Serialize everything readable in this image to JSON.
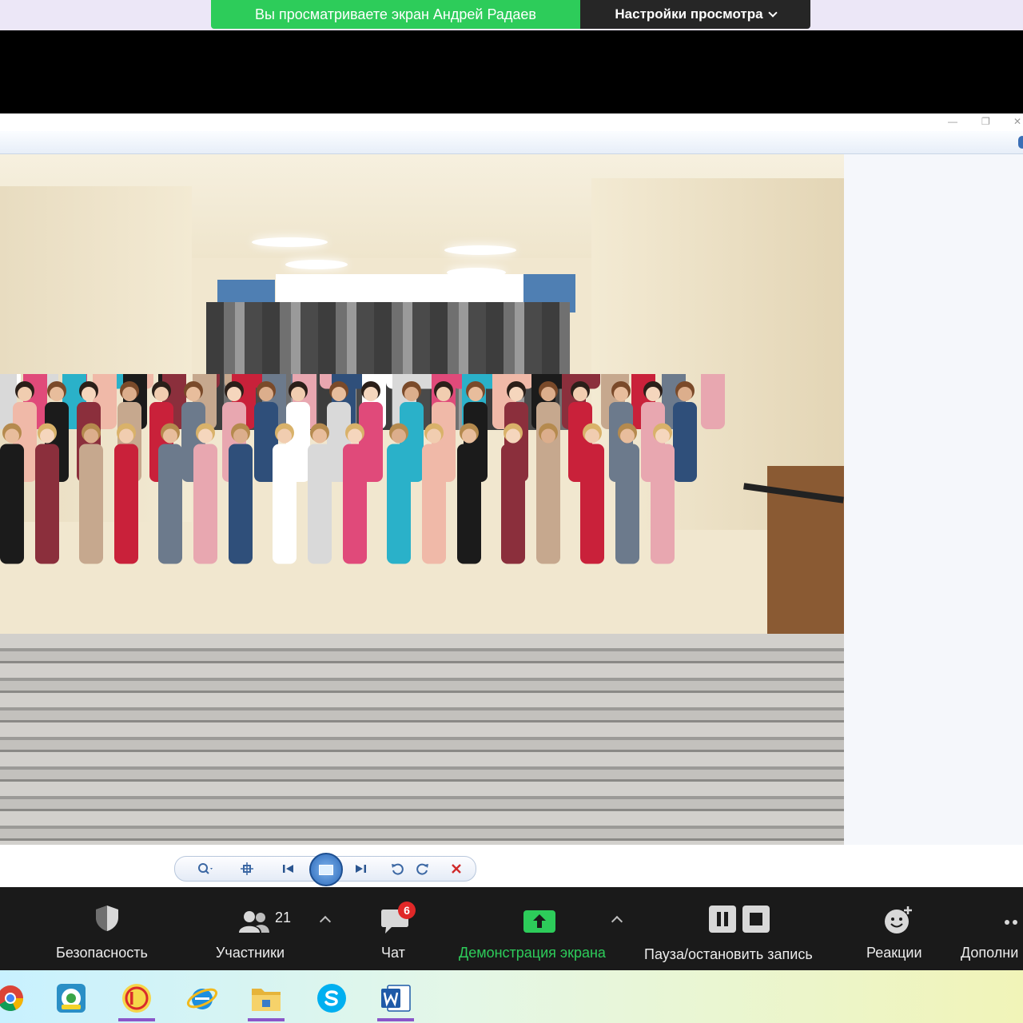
{
  "share_banner": {
    "viewing_text": "Вы просматриваете экран Андрей Радаев",
    "view_options_label": "Настройки просмотра"
  },
  "viewer": {
    "window_controls": [
      "—",
      "❐",
      "✕"
    ],
    "toolbar_icons": [
      "zoom-icon",
      "fit-icon",
      "previous-icon",
      "slideshow-icon",
      "next-icon",
      "rotate-left-icon",
      "rotate-right-icon",
      "delete-icon"
    ]
  },
  "meeting_toolbar": {
    "security_label": "Безопасность",
    "participants_label": "Участники",
    "participants_count": "21",
    "chat_label": "Чат",
    "chat_badge": "6",
    "share_screen_label": "Демонстрация экрана",
    "record_label": "Пауза/остановить запись",
    "reactions_label": "Реакции",
    "more_label": "Дополни"
  },
  "colors": {
    "accent_green": "#2dcc5a",
    "toolbar_bg": "#1a1a1a",
    "badge_red": "#e02828"
  },
  "taskbar": {
    "apps": [
      "chrome-icon",
      "1c-enterprise-icon",
      "1c-icon",
      "internet-explorer-icon",
      "file-explorer-icon",
      "skype-icon",
      "word-icon"
    ]
  }
}
